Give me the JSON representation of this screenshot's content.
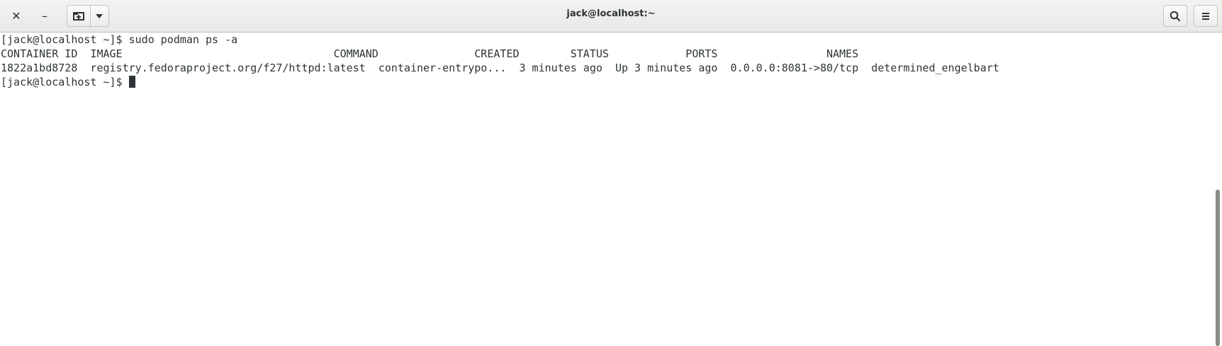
{
  "window": {
    "title": "jack@localhost:~",
    "close_label": "✕",
    "minimize_label": "–"
  },
  "icons": {
    "close": "close-icon",
    "minimize": "minimize-icon",
    "new_tab": "new-tab-icon",
    "tab_menu": "chevron-down-icon",
    "search": "search-icon",
    "menu": "hamburger-icon"
  },
  "terminal": {
    "lines": [
      "[jack@localhost ~]$ sudo podman ps -a",
      "CONTAINER ID  IMAGE                                 COMMAND               CREATED        STATUS            PORTS                 NAMES",
      "1822a1bd8728  registry.fedoraproject.org/f27/httpd:latest  container-entrypo...  3 minutes ago  Up 3 minutes ago  0.0.0.0:8081->80/tcp  determined_engelbart"
    ],
    "prompt": "[jack@localhost ~]$ ",
    "header_cols": [
      "CONTAINER ID",
      "IMAGE",
      "COMMAND",
      "CREATED",
      "STATUS",
      "PORTS",
      "NAMES"
    ],
    "row": [
      "1822a1bd8728",
      "registry.fedoraproject.org/f27/httpd:latest",
      "container-entrypo...",
      "3 minutes ago",
      "Up 3 minutes ago",
      "0.0.0.0:8081->80/tcp",
      "determined_engelbart"
    ]
  }
}
